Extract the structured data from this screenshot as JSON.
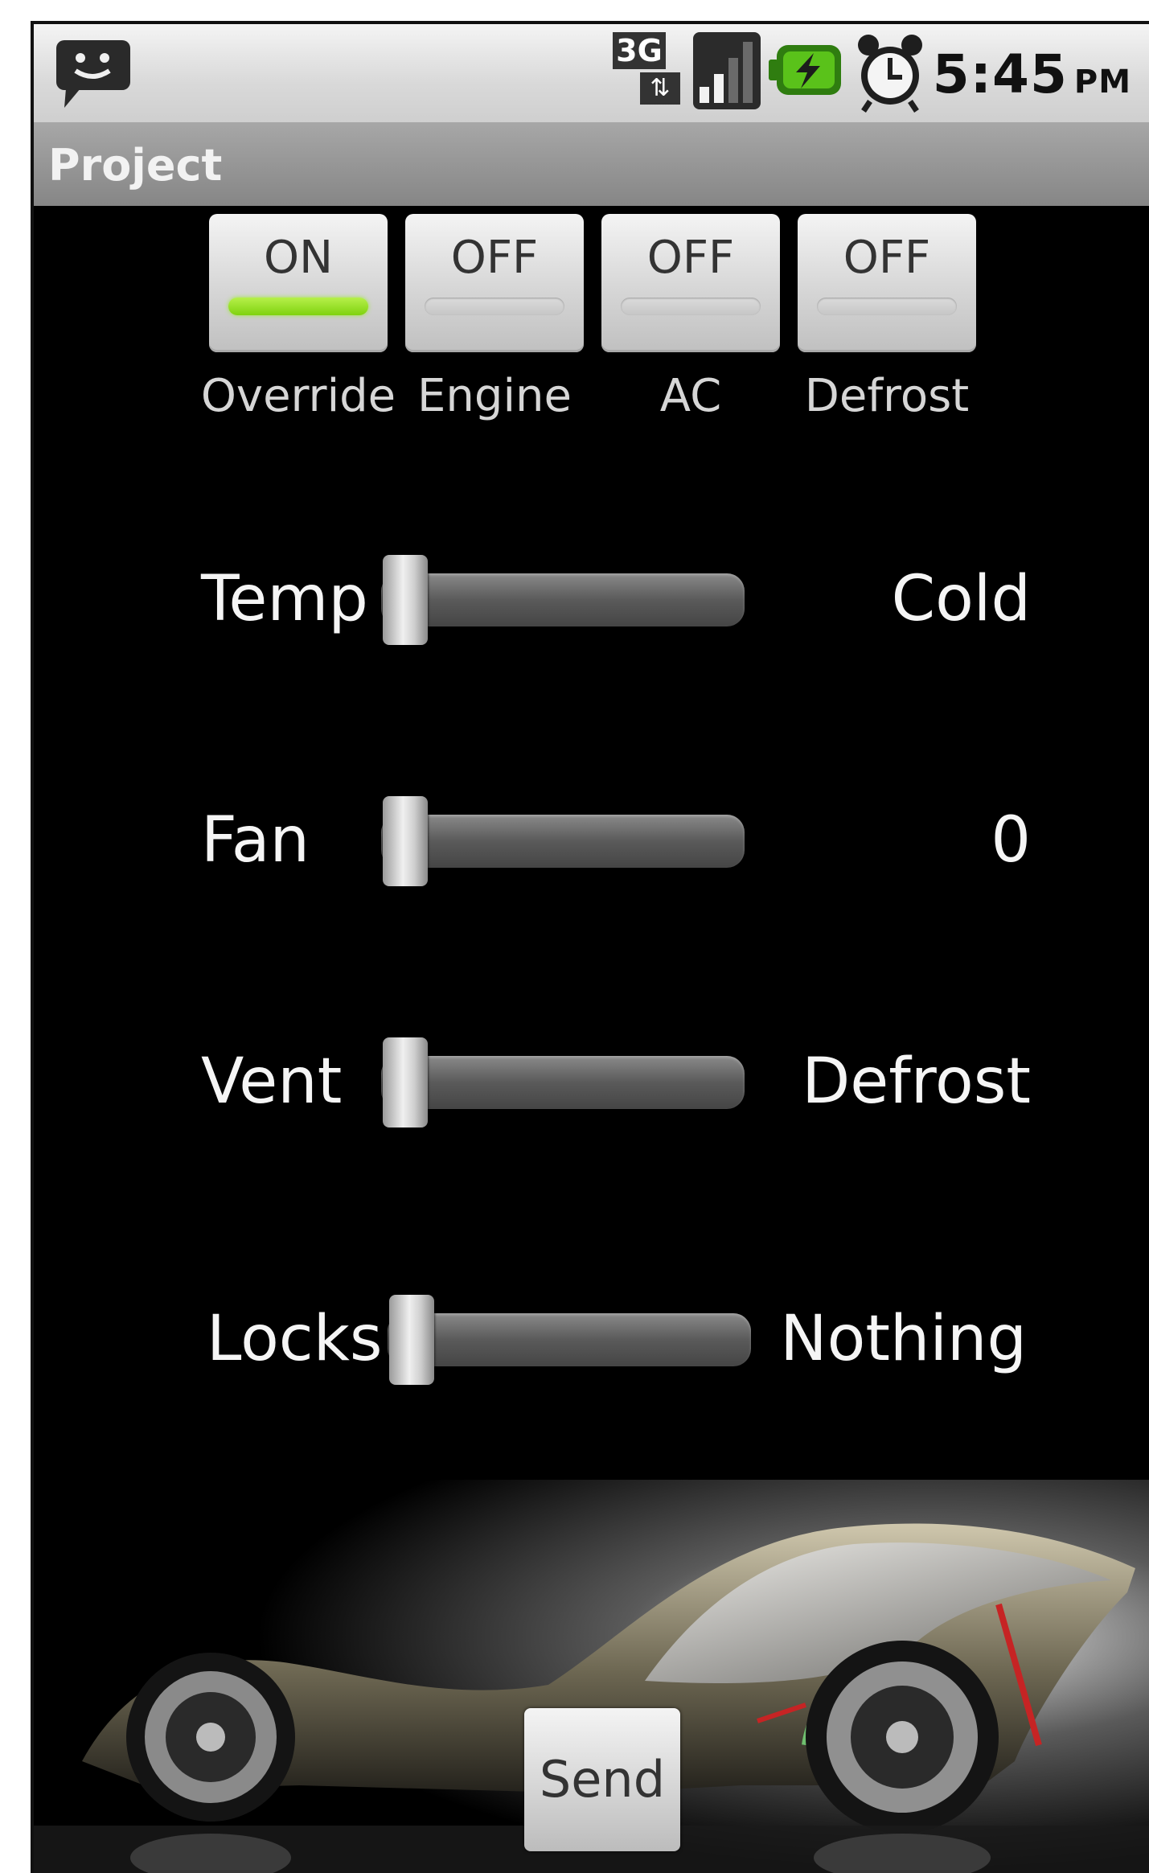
{
  "status_bar": {
    "network": "3G",
    "time": "5:45",
    "ampm": "PM",
    "icons": [
      "chat-notification-icon",
      "3g-data-icon",
      "signal-strength-icon",
      "battery-charging-icon",
      "alarm-clock-icon"
    ]
  },
  "title_bar": {
    "title": "Project"
  },
  "toggles": [
    {
      "state": "ON",
      "caption": "Override"
    },
    {
      "state": "OFF",
      "caption": "Engine"
    },
    {
      "state": "OFF",
      "caption": "AC"
    },
    {
      "state": "OFF",
      "caption": "Defrost"
    }
  ],
  "sliders": [
    {
      "label": "Temp",
      "value": "Cold",
      "level": 0
    },
    {
      "label": "Fan",
      "value": "0",
      "level": 0
    },
    {
      "label": "Vent",
      "value": "Defrost",
      "level": 0
    },
    {
      "label": "Locks",
      "value": "Nothing",
      "level": 0
    }
  ],
  "send_button": {
    "label": "Send"
  },
  "colors": {
    "on_indicator": "#8fe01f",
    "background": "#000000"
  }
}
